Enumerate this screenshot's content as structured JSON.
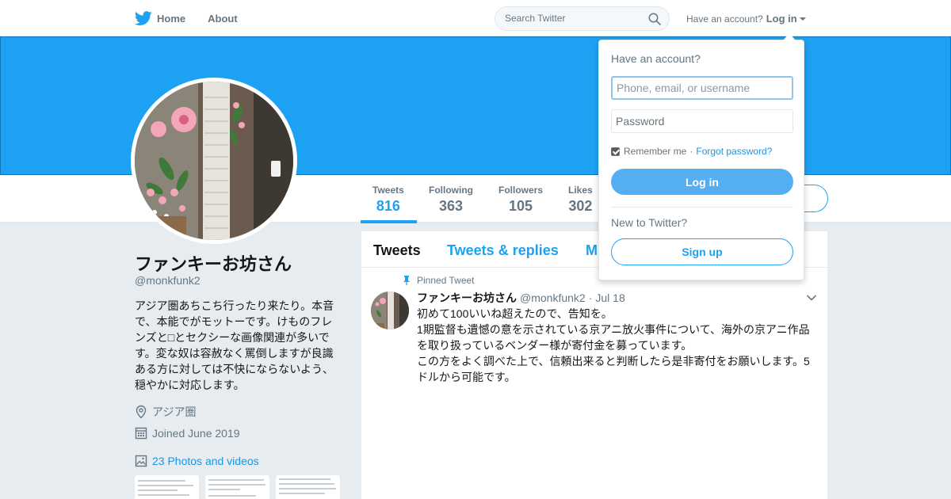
{
  "nav": {
    "home_label": "Home",
    "about_label": "About",
    "search_placeholder": "Search Twitter",
    "have_account": "Have an account?",
    "login_label": "Log in"
  },
  "profile": {
    "name": "ファンキーお坊さん",
    "handle": "@monkfunk2",
    "bio": "アジア圏あちこち行ったり来たり。本音で、本能でがモットーです。けものフレンズと□とセクシーな画像関連が多いです。変な奴は容赦なく罵倒しますが良識ある方に対しては不快にならないよう、穏やかに対応します。",
    "location": "アジア圏",
    "joined": "Joined June 2019",
    "photos_link": "23 Photos and videos"
  },
  "stats": [
    {
      "label": "Tweets",
      "value": "816",
      "active": true
    },
    {
      "label": "Following",
      "value": "363"
    },
    {
      "label": "Followers",
      "value": "105"
    },
    {
      "label": "Likes",
      "value": "302"
    }
  ],
  "timeline": {
    "tabs": [
      "Tweets",
      "Tweets & replies",
      "M"
    ],
    "pinned_label": "Pinned Tweet",
    "tweet": {
      "name": "ファンキーお坊さん",
      "handle": "@monkfunk2",
      "separator": "·",
      "date": "Jul 18",
      "lines": [
        "初めて100いいね超えたので、告知を。",
        "1期監督も遺憾の意を示されている京アニ放火事件について、海外の京アニ作品を取り扱っているベンダー様が寄付金を募っています。",
        "この方をよく調べた上で、信頼出来ると判断したら是非寄付をお願いします。5ドルから可能です。"
      ]
    }
  },
  "login_dropdown": {
    "title": "Have an account?",
    "username_placeholder": "Phone, email, or username",
    "password_placeholder": "Password",
    "remember_me": "Remember me",
    "separator": "·",
    "forgot_password": "Forgot password?",
    "login_button": "Log in",
    "new_to_twitter": "New to Twitter?",
    "signup_button": "Sign up"
  },
  "colors": {
    "brand": "#1da1f2",
    "link": "#1b95e0",
    "text": "#14171a",
    "muted": "#657786",
    "background": "#e6ecf0"
  },
  "icons": [
    "twitter-bird-icon",
    "search-icon",
    "location-pin-icon",
    "calendar-icon",
    "photo-icon",
    "pin-icon",
    "chevron-down-icon"
  ]
}
